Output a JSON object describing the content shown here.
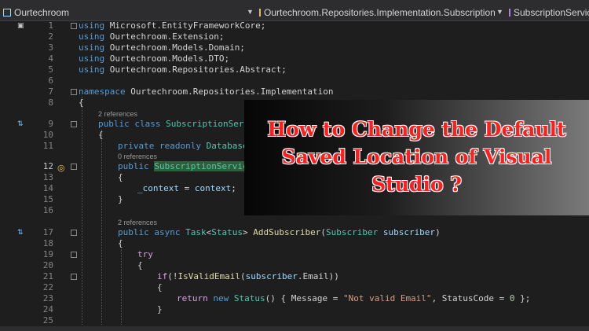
{
  "nav": {
    "project": "Ourtechroom",
    "class_path": "Ourtechroom.Repositories.Implementation.SubscriptionService",
    "member": "SubscriptionService"
  },
  "overlay": {
    "line1": "How to Change the Default",
    "line2": "Saved Location of Visual",
    "line3": "Studio ?"
  },
  "codelens": {
    "class_refs": "2 references",
    "field_refs": "0 references",
    "method_refs": "2 references"
  },
  "line_numbers": [
    "1",
    "2",
    "3",
    "4",
    "5",
    "6",
    "7",
    "8",
    "9",
    "10",
    "11",
    "12",
    "13",
    "14",
    "15",
    "16",
    "17",
    "18",
    "19",
    "20",
    "21",
    "22",
    "23",
    "24",
    "25"
  ],
  "code": {
    "l1_kw": "using",
    "l1_rest": " Microsoft.EntityFrameworkCore;",
    "l2_kw": "using",
    "l2_rest": " Ourtechroom.Extension;",
    "l3_kw": "using",
    "l3_rest": " Ourtechroom.Models.Domain;",
    "l4_kw": "using",
    "l4_rest": " Ourtechroom.Models.DTO;",
    "l5_kw": "using",
    "l5_rest": " Ourtechroom.Repositories.Abstract;",
    "l7_kw": "namespace",
    "l7_rest": " Ourtechroom.Repositories.Implementation",
    "brace_open": "{",
    "brace_close": "}",
    "l9_kw1": "public",
    "l9_kw2": "class",
    "l9_type": "SubscriptionServi",
    "l11_kw1": "private",
    "l11_kw2": "readonly",
    "l11_type": "DatabaseC",
    "l12_kw": "public",
    "l12_type": "SubscriptionService",
    "l14_var": "_context",
    "l14_eq": " = ",
    "l14_param": "context",
    "l14_semi": ";",
    "l17_kw1": "public",
    "l17_kw2": "async",
    "l17_type1": "Task",
    "l17_lt": "<",
    "l17_type2": "Status",
    "l17_gt": ">",
    "l17_fn": "AddSubscriber",
    "l17_po": "(",
    "l17_type3": "Subscriber",
    "l17_param": "subscriber",
    "l17_pc": ")",
    "l19_ctl": "try",
    "l21_ctl": "if",
    "l21_a": "(!",
    "l21_fn": "IsValidEmail",
    "l21_b": "(",
    "l21_param": "subscriber",
    "l21_c": ".Email))",
    "l23_ctl": "return",
    "l23_kw": "new",
    "l23_type": "Status",
    "l23_a": "() { Message = ",
    "l23_str": "\"Not valid Email\"",
    "l23_b": ", StatusCode = ",
    "l23_num": "0",
    "l23_c": " };"
  },
  "colors": {
    "editor_bg": "#1e1e1e",
    "keyword": "#569cd6",
    "type": "#4ec9b0",
    "control": "#d8a0df",
    "method": "#dcdcaa",
    "string": "#d69d85",
    "overlay_text": "#ff1f1f"
  }
}
